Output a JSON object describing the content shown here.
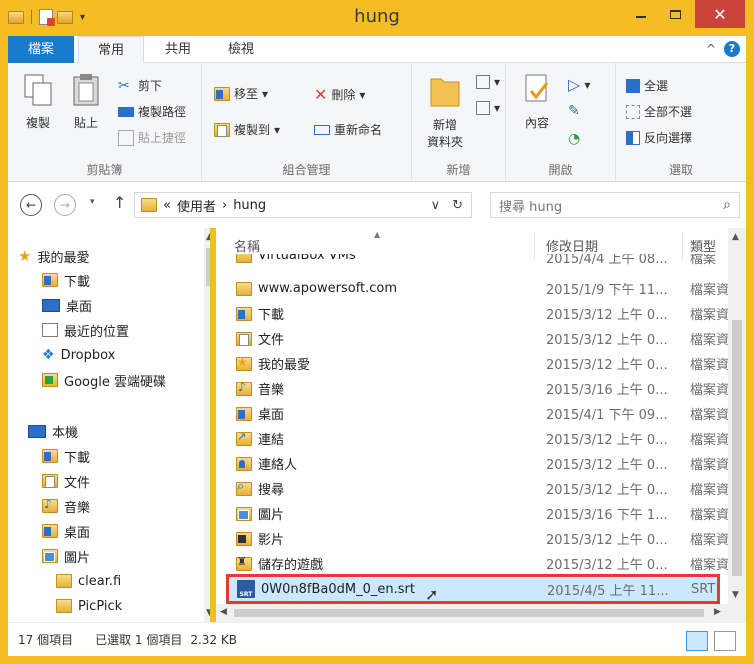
{
  "window": {
    "title": "hung",
    "minimize_label": "–",
    "maximize_label": "□",
    "close_label": "✕"
  },
  "ribbon": {
    "tabs": {
      "file": "檔案",
      "home": "常用",
      "share": "共用",
      "view": "檢視"
    },
    "collapse_label": "^",
    "help_label": "?",
    "clipboard": {
      "copy": "複製",
      "paste": "貼上",
      "cut": "剪下",
      "copy_path": "複製路徑",
      "paste_shortcut": "貼上捷徑",
      "group": "剪貼簿"
    },
    "organize": {
      "move_to": "移至",
      "copy_to": "複製到",
      "delete": "刪除",
      "rename": "重新命名",
      "group": "組合管理"
    },
    "new": {
      "new_folder_line1": "新增",
      "new_folder_line2": "資料夾",
      "group": "新增"
    },
    "open": {
      "properties": "內容",
      "group": "開啟"
    },
    "select": {
      "select_all": "全選",
      "select_none": "全部不選",
      "invert": "反向選擇",
      "group": "選取"
    }
  },
  "address": {
    "chevrons": "«",
    "crumb1": "使用者",
    "sep": "›",
    "crumb2": "hung",
    "search_placeholder": "搜尋 hung"
  },
  "nav": {
    "items": [
      {
        "label": "我的最愛"
      },
      {
        "label": "下載"
      },
      {
        "label": "桌面"
      },
      {
        "label": "最近的位置"
      },
      {
        "label": "Dropbox"
      },
      {
        "label": "Google 雲端硬碟"
      },
      {
        "label": "本機"
      },
      {
        "label": "下載"
      },
      {
        "label": "文件"
      },
      {
        "label": "音樂"
      },
      {
        "label": "桌面"
      },
      {
        "label": "圖片"
      },
      {
        "label": "clear.fi"
      },
      {
        "label": "PicPick"
      }
    ]
  },
  "columns": {
    "name": "名稱",
    "date": "修改日期",
    "type": "類型"
  },
  "files": [
    {
      "name": "VirtualBox VMs",
      "date": "2015/4/4 上午 08...",
      "type": "檔案資",
      "icon": "folder"
    },
    {
      "name": "www.apowersoft.com",
      "date": "2015/1/9 下午 11...",
      "type": "檔案資",
      "icon": "folder"
    },
    {
      "name": "下載",
      "date": "2015/3/12 上午 0...",
      "type": "檔案資",
      "icon": "folder-download"
    },
    {
      "name": "文件",
      "date": "2015/3/12 上午 0...",
      "type": "檔案資",
      "icon": "folder-documents"
    },
    {
      "name": "我的最愛",
      "date": "2015/3/12 上午 0...",
      "type": "檔案資",
      "icon": "folder-favorites"
    },
    {
      "name": "音樂",
      "date": "2015/3/16 上午 0...",
      "type": "檔案資",
      "icon": "folder-music"
    },
    {
      "name": "桌面",
      "date": "2015/4/1 下午 09...",
      "type": "檔案資",
      "icon": "folder-desktop"
    },
    {
      "name": "連結",
      "date": "2015/3/12 上午 0...",
      "type": "檔案資",
      "icon": "folder-links"
    },
    {
      "name": "連絡人",
      "date": "2015/3/12 上午 0...",
      "type": "檔案資",
      "icon": "folder-contacts"
    },
    {
      "name": "搜尋",
      "date": "2015/3/12 上午 0...",
      "type": "檔案資",
      "icon": "folder-searches"
    },
    {
      "name": "圖片",
      "date": "2015/3/16 下午 1...",
      "type": "檔案資",
      "icon": "folder-pictures"
    },
    {
      "name": "影片",
      "date": "2015/3/12 上午 0...",
      "type": "檔案資",
      "icon": "folder-videos"
    },
    {
      "name": "儲存的遊戲",
      "date": "2015/3/12 上午 0...",
      "type": "檔案資",
      "icon": "folder-saved-games"
    },
    {
      "name": "0W0n8fBa0dM_0_en.srt",
      "date": "2015/4/5 上午 11...",
      "type": "SRT",
      "icon": "srt-file",
      "selected": true
    }
  ],
  "status": {
    "count": "17 個項目",
    "selected": "已選取 1 個項目",
    "size": "2.32 KB"
  },
  "colors": {
    "title_bar": "#f3bd23",
    "file_tab": "#1979ca",
    "close": "#c8443a",
    "selection": "#cce8ff",
    "highlight_box": "#e53935"
  }
}
